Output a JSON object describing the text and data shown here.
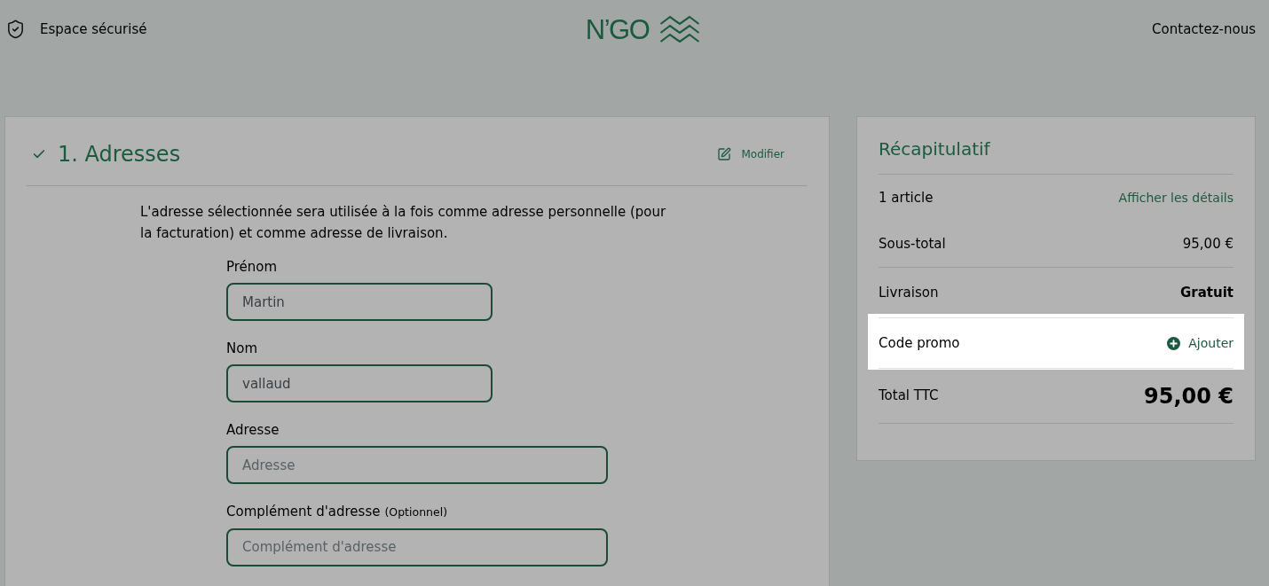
{
  "header": {
    "secure_label": "Espace sécurisé",
    "logo_text": "N’GO",
    "contact_link": "Contactez-nous"
  },
  "address_section": {
    "title": "1. Adresses",
    "completed": true,
    "edit_label": "Modifier",
    "intro": "L'adresse sélectionnée sera utilisée à la fois comme adresse personnelle (pour la facturation) et comme adresse de livraison.",
    "fields": [
      {
        "kind": "short",
        "label": "Prénom",
        "value": "Martin"
      },
      {
        "kind": "short",
        "label": "Nom",
        "value": "vallaud"
      },
      {
        "kind": "wide",
        "label": "Adresse",
        "placeholder": "Adresse"
      },
      {
        "kind": "wide",
        "label": "Complément d'adresse",
        "note": "(Optionnel)",
        "placeholder": "Complément d'adresse"
      }
    ]
  },
  "summary": {
    "title": "Récapitulatif",
    "rows": [
      {
        "kind": "link",
        "label": "1 article",
        "value": "Afficher les détails",
        "highlighted": false
      },
      {
        "kind": "amount",
        "label": "Sous-total",
        "value": "95,00 €",
        "highlighted": false
      },
      {
        "kind": "bold",
        "label": "Livraison",
        "value": "Gratuit",
        "highlighted": false
      },
      {
        "kind": "add",
        "label": "Code promo",
        "value": "Ajouter",
        "highlighted": true
      },
      {
        "kind": "total",
        "label": "Total TTC",
        "value": "95,00 €",
        "highlighted": false
      }
    ]
  }
}
